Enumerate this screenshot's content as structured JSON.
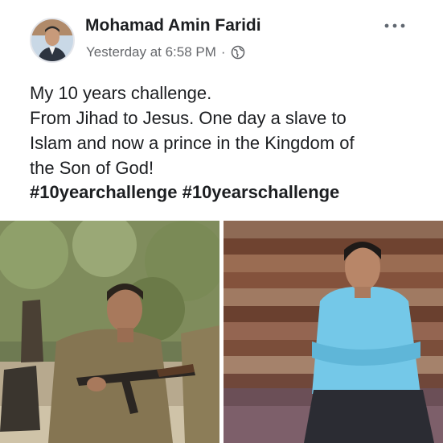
{
  "post": {
    "author": "Mohamad Amin Faridi",
    "timestamp": "Yesterday at 6:58 PM",
    "separator": "·",
    "privacy_icon": "globe-icon",
    "more_icon": "more-options-icon",
    "text_lines": [
      "My 10 years challenge.",
      "From Jihad to Jesus. One day a slave to",
      "Islam and now a prince in the Kingdom of",
      "the Son of God!"
    ],
    "hashtags": [
      "#10yearchallenge",
      "#10yearschallenge"
    ]
  },
  "photos": [
    {
      "name": "then-photo",
      "subject": "young man in military uniform holding a rifle"
    },
    {
      "name": "now-photo",
      "subject": "man in light blue shirt seated in front of wooden wall"
    }
  ],
  "colors": {
    "text": "#1c1e21",
    "meta": "#65676b",
    "background": "#ffffff",
    "shirt": "#6ec6e6",
    "wood": "#8a5a3c"
  }
}
